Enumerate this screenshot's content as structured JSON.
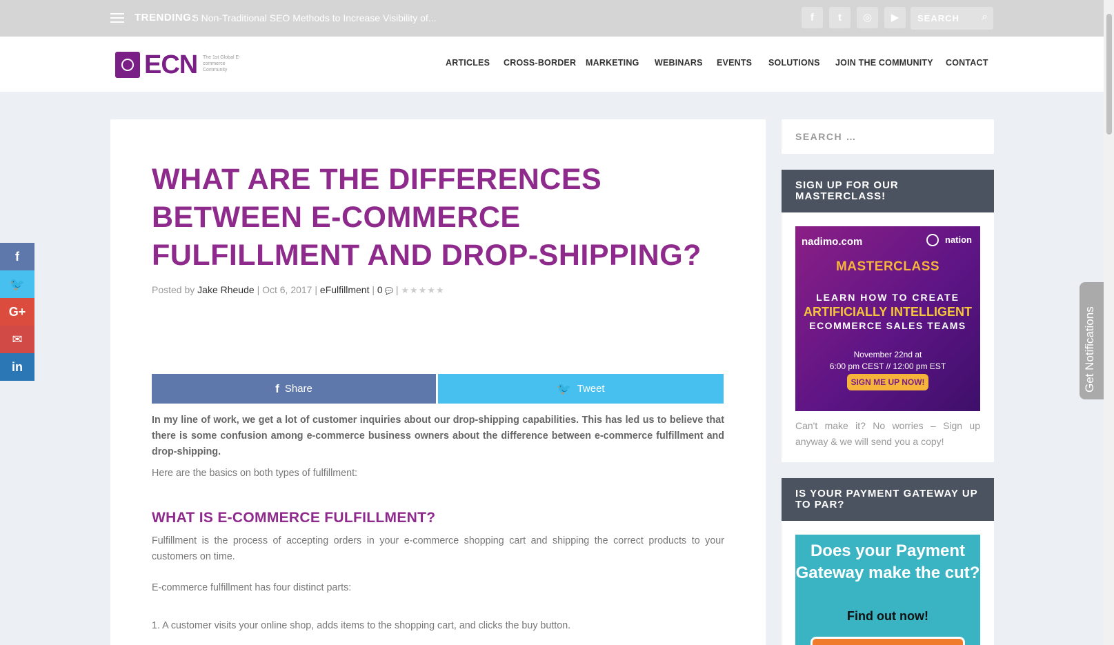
{
  "topbar": {
    "trending_label": "TRENDING:",
    "trending_text": "5 Non-Traditional SEO Methods to Increase Visibility of...",
    "search_placeholder": "SEARCH",
    "social": [
      "f",
      "t",
      "◎",
      "▶"
    ]
  },
  "header": {
    "logo_text": "ECN",
    "logo_tagline": "The 1st Global E-commerce Community",
    "nav": [
      "ARTICLES",
      "CROSS-BORDER",
      "MARKETING",
      "WEBINARS",
      "EVENTS",
      "SOLUTIONS",
      "JOIN THE COMMUNITY",
      "CONTACT"
    ]
  },
  "post": {
    "title": "WHAT ARE THE DIFFERENCES BETWEEN E-COMMERCE FULFILLMENT AND DROP-SHIPPING?",
    "meta_posted_by": "Posted by",
    "author": "Jake Rheude",
    "date": "Oct 6, 2017",
    "category": "eFulfillment",
    "comments": "0",
    "stars": "★★★★★",
    "share_label": "Share",
    "tweet_label": "Tweet",
    "intro": "In my line of work, we get a lot of customer inquiries about our drop-shipping capabilities. This has led us to believe that there is some confusion among e-commerce business owners about the difference between e-commerce fulfillment and drop-shipping.",
    "basics": "Here are the basics on both types of fulfillment:",
    "subhead": "WHAT IS E-COMMERCE FULFILLMENT?",
    "fulfillment_def": "Fulfillment is the process of accepting orders in your e-commerce shopping cart and shipping the correct products to your customers on time.",
    "four_parts": "E-commerce fulfillment has four distinct parts:",
    "list_item_1": "1. A customer visits your online shop, adds items to the shopping cart, and clicks the buy button."
  },
  "side_social": [
    "f",
    "🐦",
    "G+",
    "✉",
    "in"
  ],
  "sidebar": {
    "search_placeholder": "SEARCH …",
    "masterclass_heading": "SIGN UP FOR OUR MASTERCLASS!",
    "promo_brand": "nadimo.com",
    "promo_nation": "nation",
    "promo_master": "MASTERCLASS",
    "promo_line1": "LEARN HOW TO CREATE",
    "promo_line2": "ARTIFICIALLY INTELLIGENT",
    "promo_line3": "ECOMMERCE SALES TEAMS",
    "promo_date1": "November 22nd at",
    "promo_date2": "6:00 pm CEST // 12:00 pm EST",
    "promo_cta": "SIGN ME UP NOW!",
    "note": "Can't make it? No worries – Sign up anyway & we will send you a copy!",
    "payment_heading": "IS YOUR PAYMENT GATEWAY UP TO PAR?",
    "promo2_title": "Does your Payment Gateway make the cut?",
    "promo2_sub": "Find out now!"
  },
  "notifications": "Get Notifications",
  "colors": {
    "brand": "#8e2a8b",
    "facebook": "#5f78ab",
    "twitter": "#47c0ef",
    "google": "#dc4c3e",
    "email": "#d24a46",
    "linkedin": "#2b77b5",
    "widget_head": "#4b5260"
  }
}
